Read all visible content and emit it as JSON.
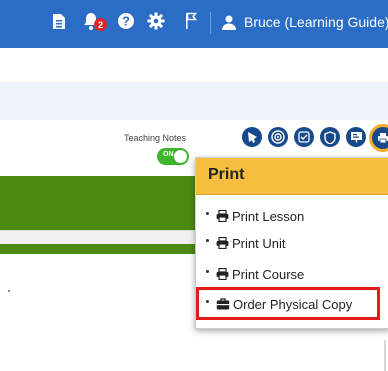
{
  "topbar": {
    "notification_count": "2",
    "user_name": "Bruce (Learning Guide)",
    "background_color": "#2b6cc4",
    "icons": [
      "document-icon",
      "bell-icon",
      "help-icon",
      "gear-icon",
      "flag-icon",
      "user-icon"
    ]
  },
  "teaching_notes": {
    "label": "Teaching Notes",
    "toggle_text": "ON"
  },
  "toolbar": {
    "icons": [
      "tag-icon",
      "target-icon",
      "checklist-icon",
      "shield-icon",
      "slides-icon",
      "print-icon"
    ]
  },
  "print_menu": {
    "title": "Print",
    "items": [
      {
        "label": "Print Lesson",
        "icon": "printer-icon"
      },
      {
        "label": "Print Unit",
        "icon": "printer-icon"
      },
      {
        "label": "Print Course",
        "icon": "printer-icon"
      },
      {
        "label": "Order Physical Copy",
        "icon": "briefcase-icon"
      }
    ],
    "header_color": "#f8be3f",
    "highlight_color": "#e31b1b"
  },
  "colors": {
    "accent_green": "#4c8a12",
    "toggle_green": "#3fb52c",
    "icon_navy": "#174a8c"
  }
}
